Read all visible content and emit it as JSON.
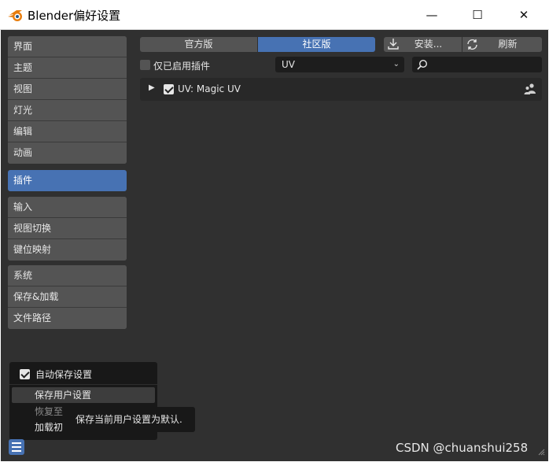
{
  "window": {
    "title": "Blender偏好设置",
    "minimize_icon": "—",
    "maximize_icon": "☐",
    "close_icon": "✕"
  },
  "sidebar": {
    "group1": [
      {
        "label": "界面"
      },
      {
        "label": "主题"
      },
      {
        "label": "视图"
      },
      {
        "label": "灯光"
      },
      {
        "label": "编辑"
      },
      {
        "label": "动画"
      }
    ],
    "group2": [
      {
        "label": "插件",
        "active": true
      }
    ],
    "group3": [
      {
        "label": "输入"
      },
      {
        "label": "视图切换"
      },
      {
        "label": "键位映射"
      }
    ],
    "group4": [
      {
        "label": "系统"
      },
      {
        "label": "保存&加载"
      },
      {
        "label": "文件路径"
      }
    ]
  },
  "addons": {
    "tabs": [
      {
        "label": "官方版"
      },
      {
        "label": "社区版",
        "active": true
      }
    ],
    "install_label": "安装...",
    "refresh_label": "刷新",
    "enabled_only_label": "仅已启用插件",
    "enabled_only_checked": false,
    "category_value": "UV",
    "search_value": "",
    "items": [
      {
        "label": "UV: Magic UV",
        "enabled": true
      }
    ]
  },
  "bottom_menu": {
    "auto_save_label": "自动保存设置",
    "auto_save_checked": true,
    "save_user_settings_label": "保存用户设置",
    "revert_label": "恢复至",
    "load_factory_label": "加载初",
    "tooltip": "保存当前用户设置为默认."
  },
  "watermark": "CSDN @chuanshui258",
  "colors": {
    "accent": "#4772b3",
    "background": "#303030",
    "button": "#545454",
    "field": "#1d1d1d"
  }
}
